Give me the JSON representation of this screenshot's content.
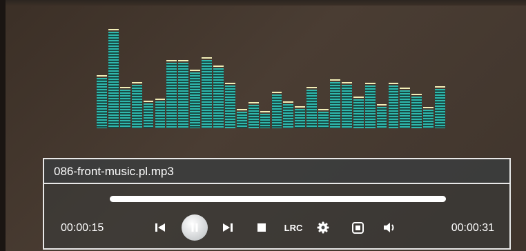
{
  "player": {
    "file_name": "086-front-music.pl.mp3",
    "time_elapsed": "00:00:15",
    "time_total": "00:00:31",
    "progress_percent": 100,
    "controls": {
      "prev": "skip-previous-icon",
      "play_pause": "pause-icon",
      "next": "skip-next-icon",
      "stop": "stop-icon",
      "lyrics_label": "LRC",
      "settings": "gear-icon",
      "display_mode": "square-frame-icon",
      "volume": "speaker-icon"
    }
  },
  "visualizer": {
    "max_level": 100,
    "levels": [
      52,
      100,
      40,
      45,
      26,
      28,
      68,
      68,
      58,
      71,
      62,
      44,
      17,
      24,
      15,
      35,
      25,
      20,
      40,
      17,
      48,
      45,
      30,
      44,
      22,
      44,
      39,
      33,
      19,
      41
    ],
    "colors": {
      "bar": "#2fb8ad",
      "cap": "#f3efb8"
    }
  },
  "colors": {
    "panel_border": "#e8e8e8",
    "text": "#ffffff"
  }
}
